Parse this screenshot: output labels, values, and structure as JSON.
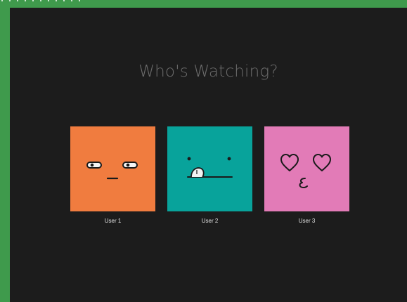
{
  "page": {
    "title": "Who's Watching?"
  },
  "profiles": [
    {
      "name": "User 1",
      "color": "#f07c3f",
      "face": "sleepy-face-icon"
    },
    {
      "name": "User 2",
      "color": "#08a39b",
      "face": "tongue-out-face-icon"
    },
    {
      "name": "User 3",
      "color": "#e27bb7",
      "face": "kissing-heart-eyes-face-icon"
    }
  ],
  "colors": {
    "background": "#1c1c1c",
    "frame": "#3f9a4c",
    "title_text": "#6c6c6c",
    "label_text": "#e2e2e2",
    "face_ink": "#1a1a1a"
  }
}
